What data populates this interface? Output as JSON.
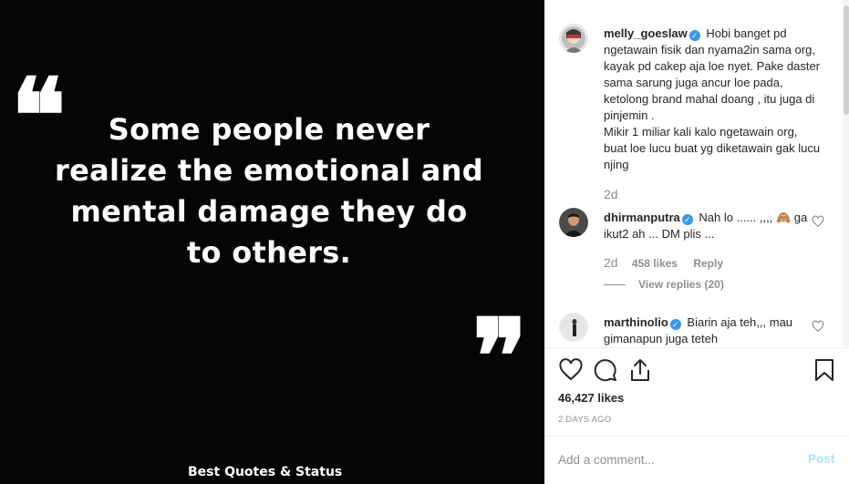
{
  "image": {
    "quote_text": "Some people never realize the emotional and mental damage they do to others.",
    "open_quote": "❝",
    "close_quote": "❞",
    "watermark": "Best Quotes & Status"
  },
  "caption": {
    "username": "melly_goeslaw",
    "verified": true,
    "text": "Hobi banget pd ngetawain fisik dan nyama2in sama org, kayak pd cakep aja loe nyet. Pake daster sama sarung juga ancur loe pada, ketolong brand mahal doang , itu juga di pinjemin .",
    "text2": "Mikir 1 miliar kali kalo ngetawain org, buat loe lucu buat yg diketawain gak lucu njing",
    "time": "2d"
  },
  "comments": [
    {
      "username": "dhirmanputra",
      "verified": true,
      "text": "Nah lo ...... ,,,, 🙈 ga ikut2 ah ... DM plis ...",
      "time": "2d",
      "likes": "458 likes",
      "reply": "Reply",
      "view_replies": "View replies (20)"
    },
    {
      "username": "marthinolio",
      "verified": true,
      "text": "Biarin aja teh,,, mau gimanapun juga teteh",
      "time": "",
      "likes": "",
      "reply": ""
    }
  ],
  "actions": {
    "like_icon": "heart-icon",
    "comment_icon": "comment-icon",
    "share_icon": "share-icon",
    "save_icon": "bookmark-icon"
  },
  "likes_count": "46,427 likes",
  "post_date": "2 DAYS AGO",
  "add_comment": {
    "placeholder": "Add a comment...",
    "post_label": "Post"
  },
  "colors": {
    "verified": "#3897f0",
    "post_button_disabled": "#b2dffc",
    "meta_text": "#8e8e8e",
    "image_background": "#050505"
  }
}
